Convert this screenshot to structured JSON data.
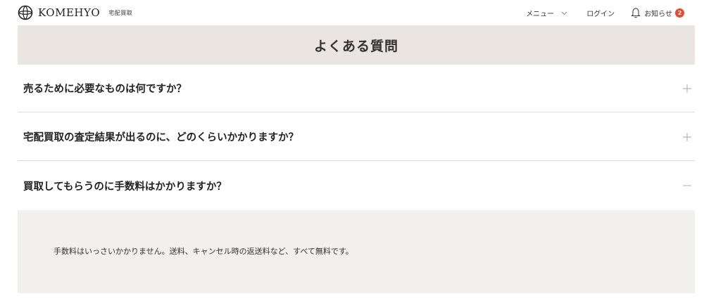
{
  "header": {
    "logo_text": "KOMEHYO",
    "logo_sub": "宅配買取",
    "menu_label": "メニュー",
    "login_label": "ログイン",
    "notice_label": "お知らせ",
    "notice_count": "2",
    "badge_color": "#e8492e"
  },
  "page": {
    "title": "よくある質問",
    "band_color": "#ebe5e1"
  },
  "faq": [
    {
      "question": "売るために必要なものは何ですか？",
      "expanded": false
    },
    {
      "question": "宅配買取の査定結果が出るのに、どのくらいかかりますか？",
      "expanded": false
    },
    {
      "question": "買取してもらうのに手数料はかかりますか？",
      "expanded": true,
      "answer": "手数料はいっさいかかりません。送料、キャンセル時の返送料など、すべて無料です。"
    }
  ]
}
